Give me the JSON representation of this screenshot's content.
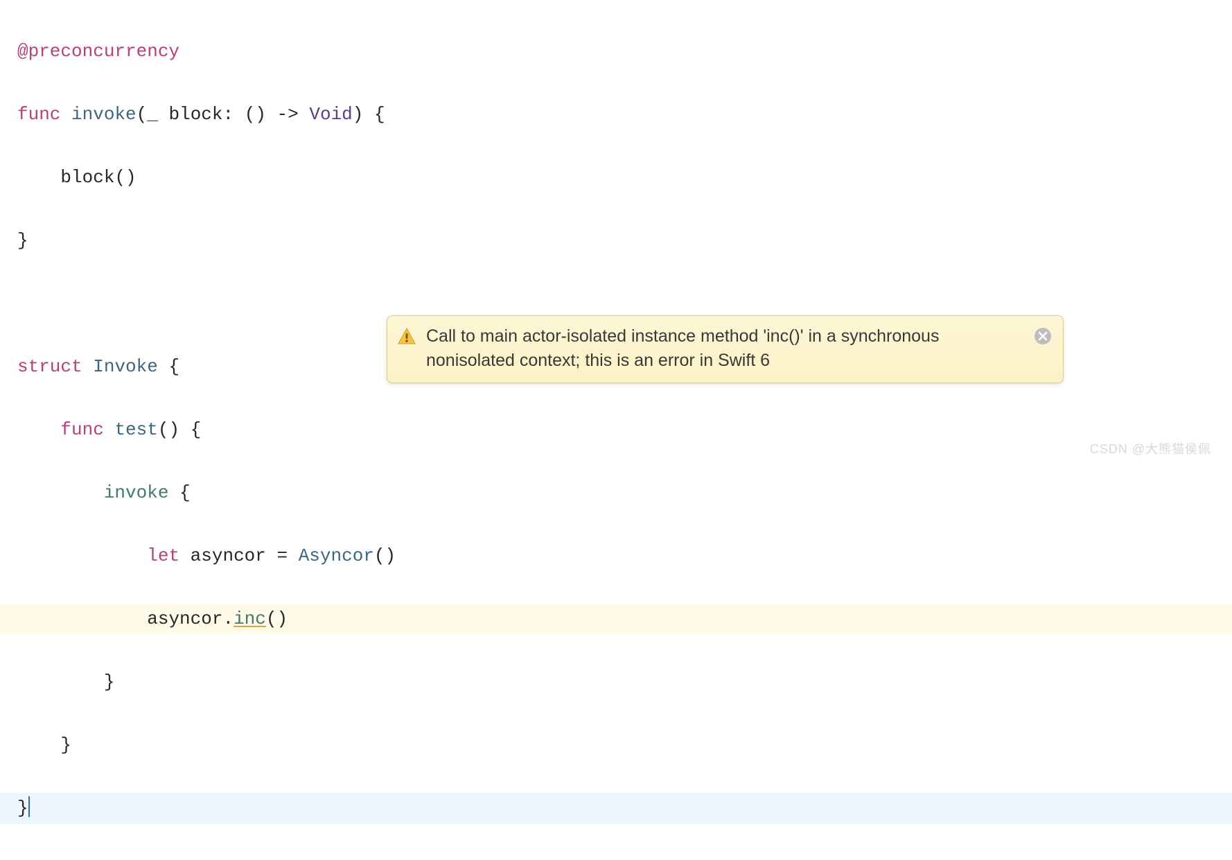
{
  "code": {
    "attribute": "@preconcurrency",
    "funcKeyword": "func",
    "invokeFunc": "invoke",
    "paramUnderscore": "_",
    "paramName": "block",
    "arrow": "->",
    "voidType": "Void",
    "blockCall": "block",
    "structKeyword": "struct",
    "structName": "Invoke",
    "testFunc": "test",
    "invokeCallName": "invoke",
    "letKeyword": "let",
    "varName": "asyncor",
    "assign": "=",
    "asyncorType": "Asyncor",
    "incMethod": "inc",
    "accessorVar": "asyncor"
  },
  "warning": {
    "message": "Call to main actor-isolated instance method 'inc()' in a synchronous nonisolated context; this is an error in Swift 6"
  },
  "watermark": {
    "text": "CSDN @大熊猫侯佩"
  }
}
